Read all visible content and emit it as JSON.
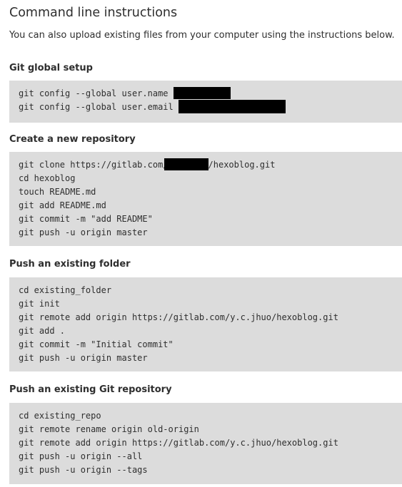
{
  "header": {
    "title": "Command line instructions",
    "intro": "You can also upload existing files from your computer using the instructions below."
  },
  "sections": [
    {
      "title": "Git global setup",
      "lines": [
        {
          "pre": "git config --global user.name ",
          "post": ""
        },
        {
          "pre": "git config --global user.email ",
          "post": ""
        }
      ]
    },
    {
      "title": "Create a new repository",
      "lines": [
        {
          "pre": "git clone https://gitlab.com/",
          "post": "/hexoblog.git"
        },
        {
          "pre": "cd hexoblog"
        },
        {
          "pre": "touch README.md"
        },
        {
          "pre": "git add README.md"
        },
        {
          "pre": "git commit -m \"add README\""
        },
        {
          "pre": "git push -u origin master"
        }
      ]
    },
    {
      "title": "Push an existing folder",
      "lines": [
        {
          "pre": "cd existing_folder"
        },
        {
          "pre": "git init"
        },
        {
          "pre": "git remote add origin https://gitlab.com/y.c.jhuo/hexoblog.git"
        },
        {
          "pre": "git add ."
        },
        {
          "pre": "git commit -m \"Initial commit\""
        },
        {
          "pre": "git push -u origin master"
        }
      ]
    },
    {
      "title": "Push an existing Git repository",
      "lines": [
        {
          "pre": "cd existing_repo"
        },
        {
          "pre": "git remote rename origin old-origin"
        },
        {
          "pre": "git remote add origin https://gitlab.com/y.c.jhuo/hexoblog.git"
        },
        {
          "pre": "git push -u origin --all"
        },
        {
          "pre": "git push -u origin --tags"
        }
      ]
    }
  ],
  "colors": {
    "text": "#2e2e2e",
    "code_background": "#dcdcdc",
    "redaction": "#000000"
  }
}
